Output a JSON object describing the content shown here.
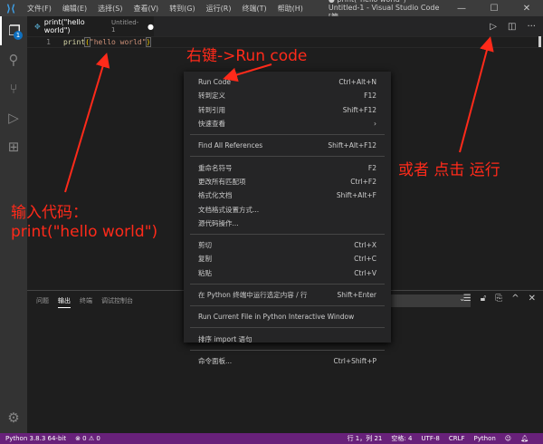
{
  "titlebar": {
    "menus": [
      "文件(F)",
      "编辑(E)",
      "选择(S)",
      "查看(V)",
      "转到(G)",
      "运行(R)",
      "终端(T)",
      "帮助(H)"
    ],
    "title": "● print(\"hello world\") • Untitled-1 - Visual Studio Code [管...",
    "minimize": "—",
    "maximize": "☐",
    "close": "✕"
  },
  "activity": {
    "badge": "1"
  },
  "tab": {
    "name": "print(\"hello world\")",
    "sub": "Untitled-1",
    "dirty": "●"
  },
  "editor": {
    "line_no": "1",
    "fn": "print",
    "open": "(",
    "str": "\"hello world\"",
    "close": ")"
  },
  "context_menu": {
    "groups": [
      [
        {
          "label": "Run Code",
          "shortcut": "Ctrl+Alt+N"
        },
        {
          "label": "转到定义",
          "shortcut": "F12"
        },
        {
          "label": "转到引用",
          "shortcut": "Shift+F12"
        },
        {
          "label": "快速查看",
          "shortcut": "›"
        }
      ],
      [
        {
          "label": "Find All References",
          "shortcut": "Shift+Alt+F12"
        }
      ],
      [
        {
          "label": "重命名符号",
          "shortcut": "F2"
        },
        {
          "label": "更改所有匹配项",
          "shortcut": "Ctrl+F2"
        },
        {
          "label": "格式化文档",
          "shortcut": "Shift+Alt+F"
        },
        {
          "label": "文档格式设置方式...",
          "shortcut": ""
        },
        {
          "label": "源代码操作...",
          "shortcut": ""
        }
      ],
      [
        {
          "label": "剪切",
          "shortcut": "Ctrl+X"
        },
        {
          "label": "复制",
          "shortcut": "Ctrl+C"
        },
        {
          "label": "粘贴",
          "shortcut": "Ctrl+V"
        }
      ],
      [
        {
          "label": "在 Python 终端中运行选定内容 / 行",
          "shortcut": "Shift+Enter"
        }
      ],
      [
        {
          "label": "Run Current File in Python Interactive Window",
          "shortcut": ""
        }
      ],
      [
        {
          "label": "排序 import 语句",
          "shortcut": ""
        }
      ],
      [
        {
          "label": "命令面板...",
          "shortcut": "Ctrl+Shift+P"
        }
      ]
    ]
  },
  "panel": {
    "tabs": [
      "问题",
      "输出",
      "终端",
      "调试控制台"
    ],
    "active": 1
  },
  "status": {
    "python": "Python 3.8.3 64-bit",
    "problems": "⊗ 0 ⚠ 0",
    "position": "行 1，列 21",
    "spaces": "空格: 4",
    "encoding": "UTF-8",
    "eol": "CRLF",
    "language": "Python"
  },
  "annotations": {
    "right_click": "右键->Run code",
    "or_click": "或者 点击 运行",
    "input_code": "输入代码：",
    "code": "print(\"hello world\")"
  },
  "colors": {
    "status_bar": "#68217a",
    "annotation": "#ff2a1a"
  }
}
